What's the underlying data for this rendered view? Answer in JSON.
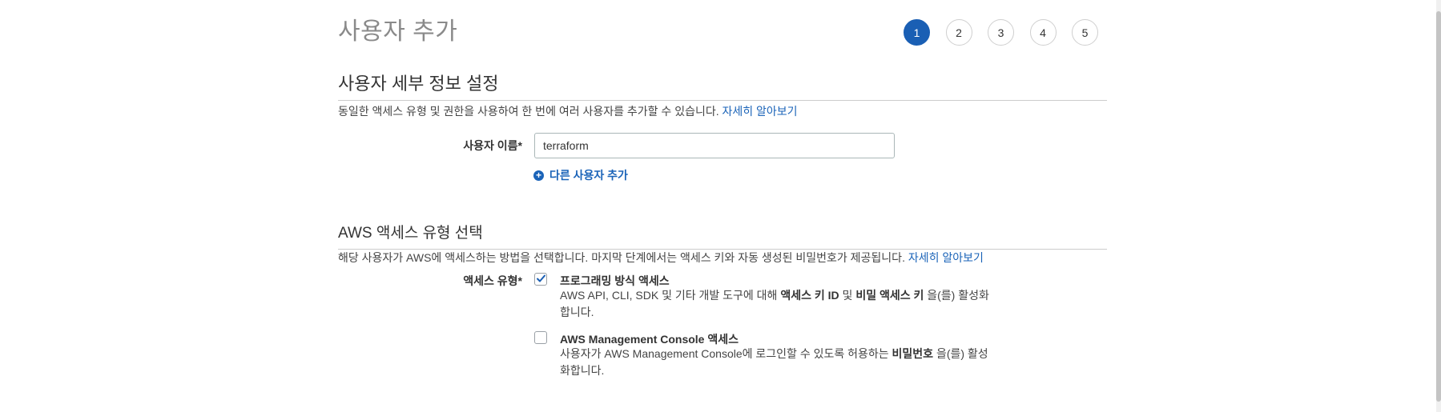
{
  "header": {
    "title": "사용자 추가"
  },
  "steps": [
    "1",
    "2",
    "3",
    "4",
    "5"
  ],
  "active_step": 1,
  "details": {
    "title": "사용자 세부 정보 설정",
    "description": "동일한 액세스 유형 및 권한을 사용하여 한 번에 여러 사용자를 추가할 수 있습니다.",
    "learn_more": "자세히 알아보기",
    "username_label": "사용자 이름*",
    "username_value": "terraform",
    "add_user_label": "다른 사용자 추가"
  },
  "access": {
    "title": "AWS 액세스 유형 선택",
    "description": "해당 사용자가 AWS에 액세스하는 방법을 선택합니다. 마지막 단계에서는 액세스 키와 자동 생성된 비밀번호가 제공됩니다.",
    "learn_more": "자세히 알아보기",
    "type_label": "액세스 유형*",
    "programmatic": {
      "title": "프로그래밍 방식 액세스",
      "checked": true,
      "desc_pre": "AWS API, CLI, SDK 및 기타 개발 도구에 대해 ",
      "desc_bold1": "액세스 키 ID",
      "desc_mid": " 및 ",
      "desc_bold2": "비밀 액세스 키",
      "desc_post": " 을(를) 활성화합니다."
    },
    "console": {
      "title": "AWS Management Console 액세스",
      "checked": false,
      "desc_pre": "사용자가 AWS Management Console에 로그인할 수 있도록 허용하는 ",
      "desc_bold": "비밀번호",
      "desc_post": " 을(를) 활성화합니다."
    }
  },
  "colors": {
    "accent": "#1a5fb4",
    "link": "#1a63b8"
  }
}
